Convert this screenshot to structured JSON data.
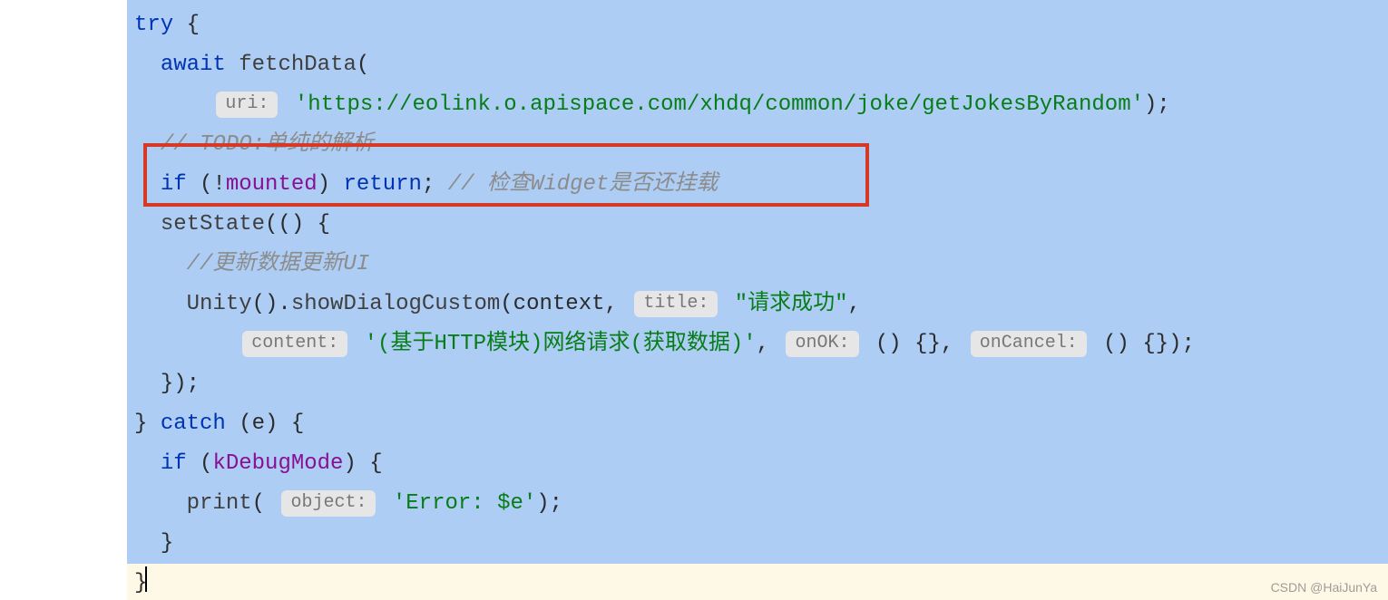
{
  "code": {
    "l1": {
      "kw": "try",
      "rest": " {"
    },
    "l2": {
      "kw": "await",
      "fn": " fetchData",
      "rest": "("
    },
    "l3": {
      "hint": "uri:",
      "str": " 'https://eolink.o.apispace.com/xhdq/common/joke/getJokesByRandom'",
      "rest": ");"
    },
    "l4": {
      "cmt": "// TODO:单纯的解析"
    },
    "l5": {
      "kw1": "if",
      "p1": " (!",
      "ident": "mounted",
      "p2": ") ",
      "kw2": "return",
      "p3": "; ",
      "cmt": "// 检查Widget是否还挂载"
    },
    "l6": {
      "fn": "setState",
      "rest": "(() {"
    },
    "l7": {
      "cmt": "//更新数据更新UI"
    },
    "l8": {
      "fn1": "Unity",
      "p1": "().",
      "fn2": "showDialogCustom",
      "p2": "(context, ",
      "hint": "title:",
      "str": " \"请求成功\"",
      "rest": ","
    },
    "l9": {
      "hint1": "content:",
      "str": " '(基于HTTP模块)网络请求(获取数据)'",
      "p1": ", ",
      "hint2": "onOK:",
      "p2": " () {}, ",
      "hint3": "onCancel:",
      "p3": " () {});"
    },
    "l10": {
      "rest": "});"
    },
    "l11": {
      "p1": "} ",
      "kw": "catch",
      "rest": " (e) {"
    },
    "l12": {
      "kw": "if",
      "p1": " (",
      "ident": "kDebugMode",
      "rest": ") {"
    },
    "l13": {
      "fn": "print",
      "p1": "( ",
      "hint": "object:",
      "str": " 'Error: $e'",
      "rest": ");"
    },
    "l14": {
      "rest": "}"
    },
    "l15": {
      "rest": "}"
    }
  },
  "watermark": "CSDN @HaiJunYa"
}
